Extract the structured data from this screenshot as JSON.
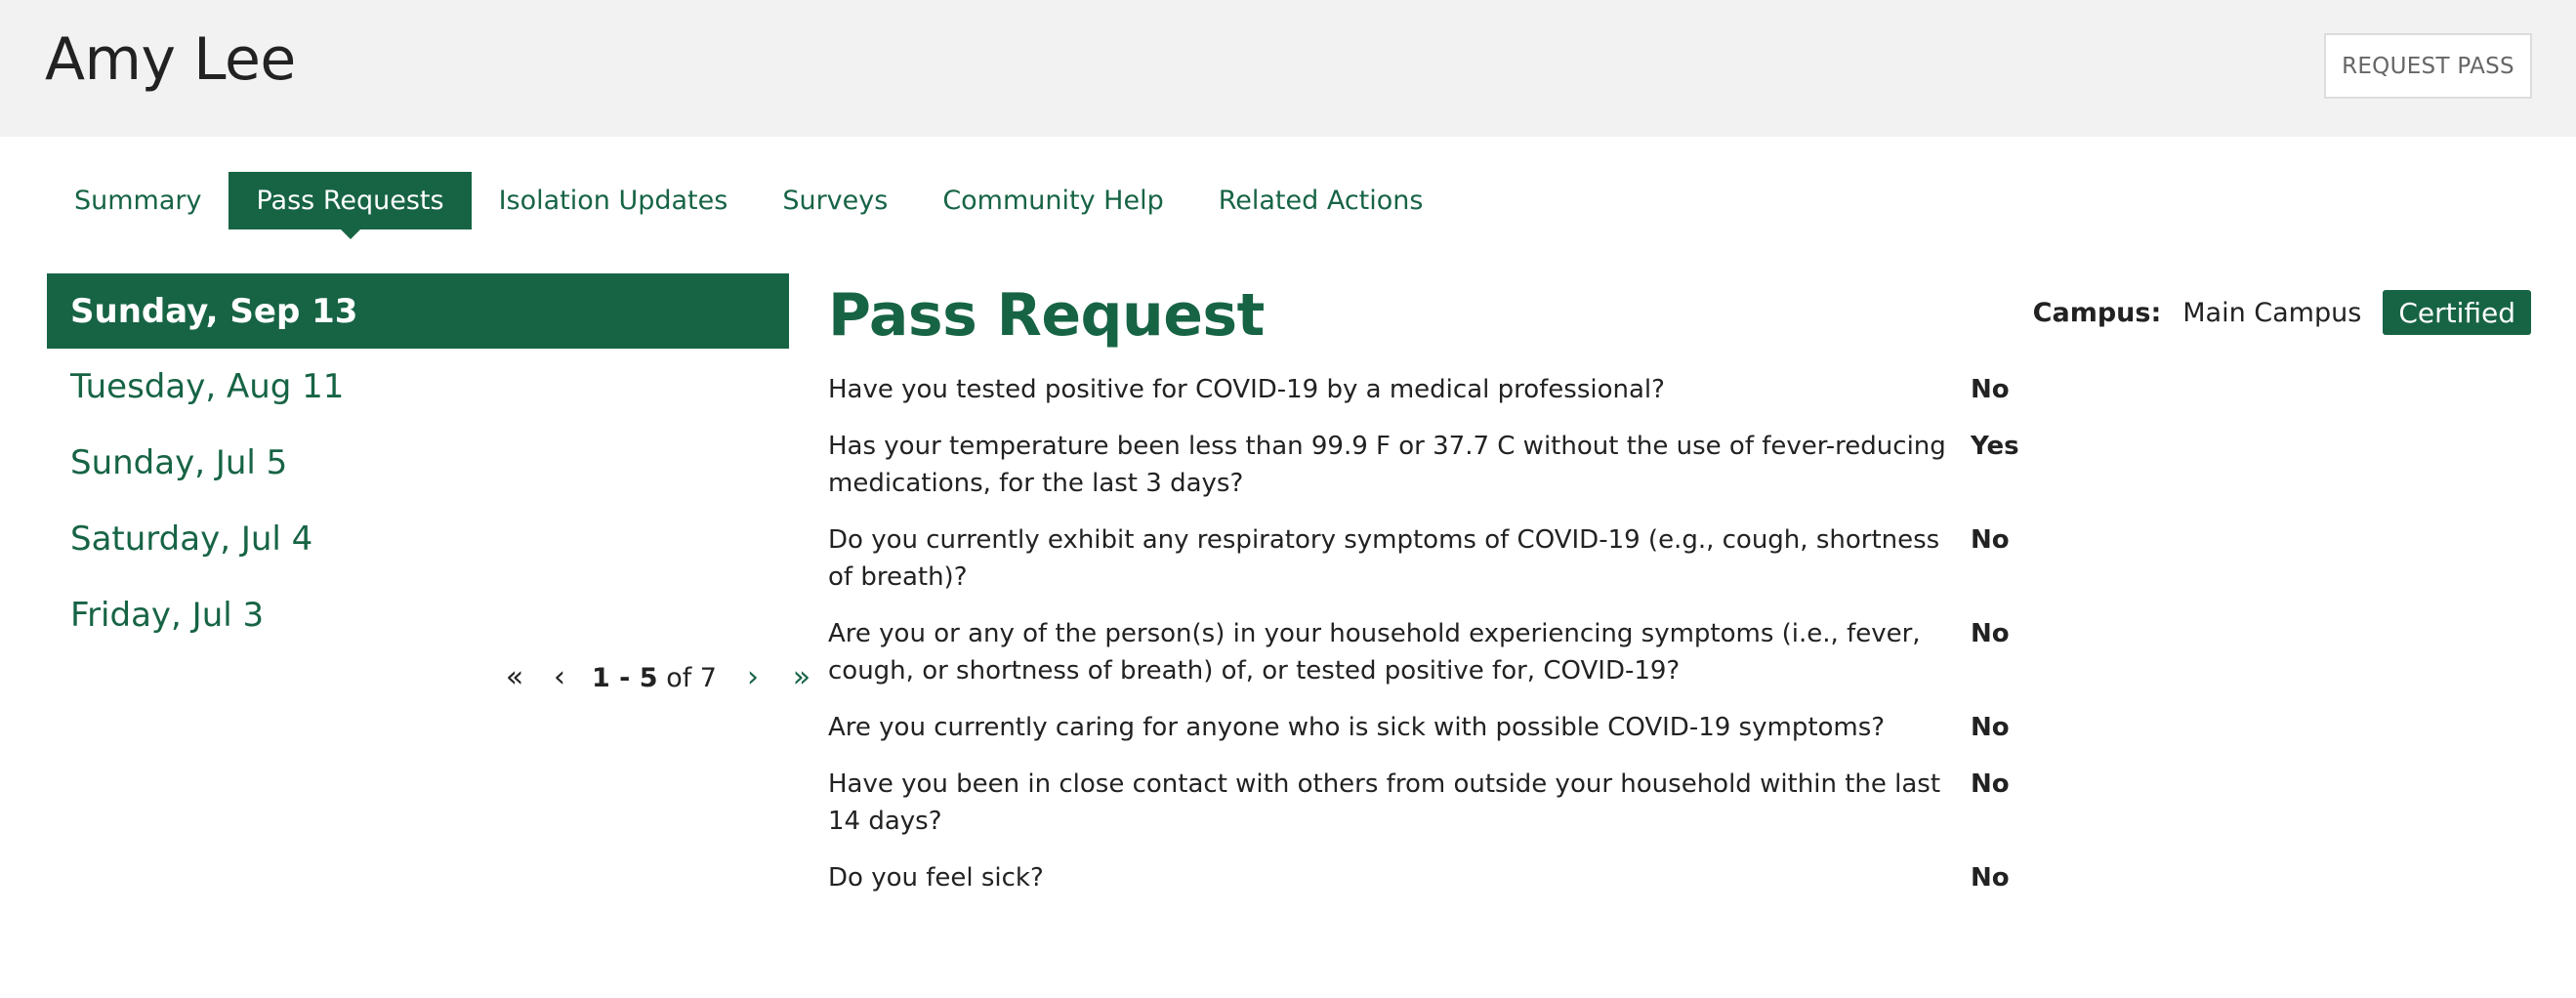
{
  "header": {
    "title": "Amy Lee",
    "request_pass_label": "REQUEST PASS"
  },
  "tabs": [
    {
      "label": "Summary",
      "active": false
    },
    {
      "label": "Pass Requests",
      "active": true
    },
    {
      "label": "Isolation Updates",
      "active": false
    },
    {
      "label": "Surveys",
      "active": false
    },
    {
      "label": "Community Help",
      "active": false
    },
    {
      "label": "Related Actions",
      "active": false
    }
  ],
  "dates": [
    {
      "label": "Sunday, Sep 13",
      "selected": true
    },
    {
      "label": "Tuesday, Aug 11",
      "selected": false
    },
    {
      "label": "Sunday, Jul 5",
      "selected": false
    },
    {
      "label": "Saturday, Jul 4",
      "selected": false
    },
    {
      "label": "Friday, Jul 3",
      "selected": false
    }
  ],
  "pagination": {
    "range": "1 - 5",
    "of_label": "of 7",
    "first_icon": "«",
    "prev_icon": "‹",
    "next_icon": "›",
    "last_icon": "»"
  },
  "pass_request": {
    "title": "Pass Request",
    "campus_label": "Campus:",
    "campus_value": "Main Campus",
    "status_badge": "Certified",
    "questions": [
      {
        "q": "Have you tested positive for COVID-19 by a medical professional?",
        "a": "No"
      },
      {
        "q": "Has your temperature been less than 99.9 F or 37.7 C without the use of fever-reducing medications, for the last 3 days?",
        "a": "Yes"
      },
      {
        "q": "Do you currently exhibit any respiratory symptoms of COVID-19 (e.g., cough, shortness of breath)?",
        "a": "No"
      },
      {
        "q": "Are you or any of the person(s) in your household experiencing symptoms (i.e., fever, cough, or shortness of breath) of, or tested positive for, COVID-19?",
        "a": "No"
      },
      {
        "q": "Are you currently caring for anyone who is sick with possible COVID-19 symptoms?",
        "a": "No"
      },
      {
        "q": "Have you been in close contact with others from outside your household within the last 14 days?",
        "a": "No"
      },
      {
        "q": "Do you feel sick?",
        "a": "No"
      }
    ]
  },
  "colors": {
    "brand_green": "#176445",
    "header_bg": "#f2f2f2"
  }
}
